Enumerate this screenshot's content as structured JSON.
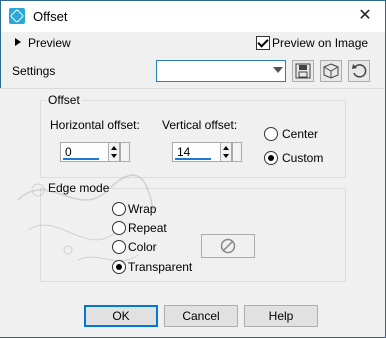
{
  "window": {
    "title": "Offset"
  },
  "header": {
    "preview_label": "Preview",
    "preview_on_image_label": "Preview on Image",
    "preview_on_image_checked": true,
    "settings_label": "Settings",
    "settings_value": ""
  },
  "offset_group": {
    "label": "Offset",
    "horizontal_label": "Horizontal offset:",
    "horizontal_value": "0",
    "vertical_label": "Vertical offset:",
    "vertical_value": "14",
    "center_label": "Center",
    "custom_label": "Custom",
    "selected": "Custom"
  },
  "edge_group": {
    "label": "Edge mode",
    "wrap_label": "Wrap",
    "repeat_label": "Repeat",
    "color_label": "Color",
    "transparent_label": "Transparent",
    "selected": "Transparent"
  },
  "buttons": {
    "ok": "OK",
    "cancel": "Cancel",
    "help": "Help"
  },
  "colors": {
    "accent": "#0078d7",
    "title_icon": "#2aa8d8"
  }
}
